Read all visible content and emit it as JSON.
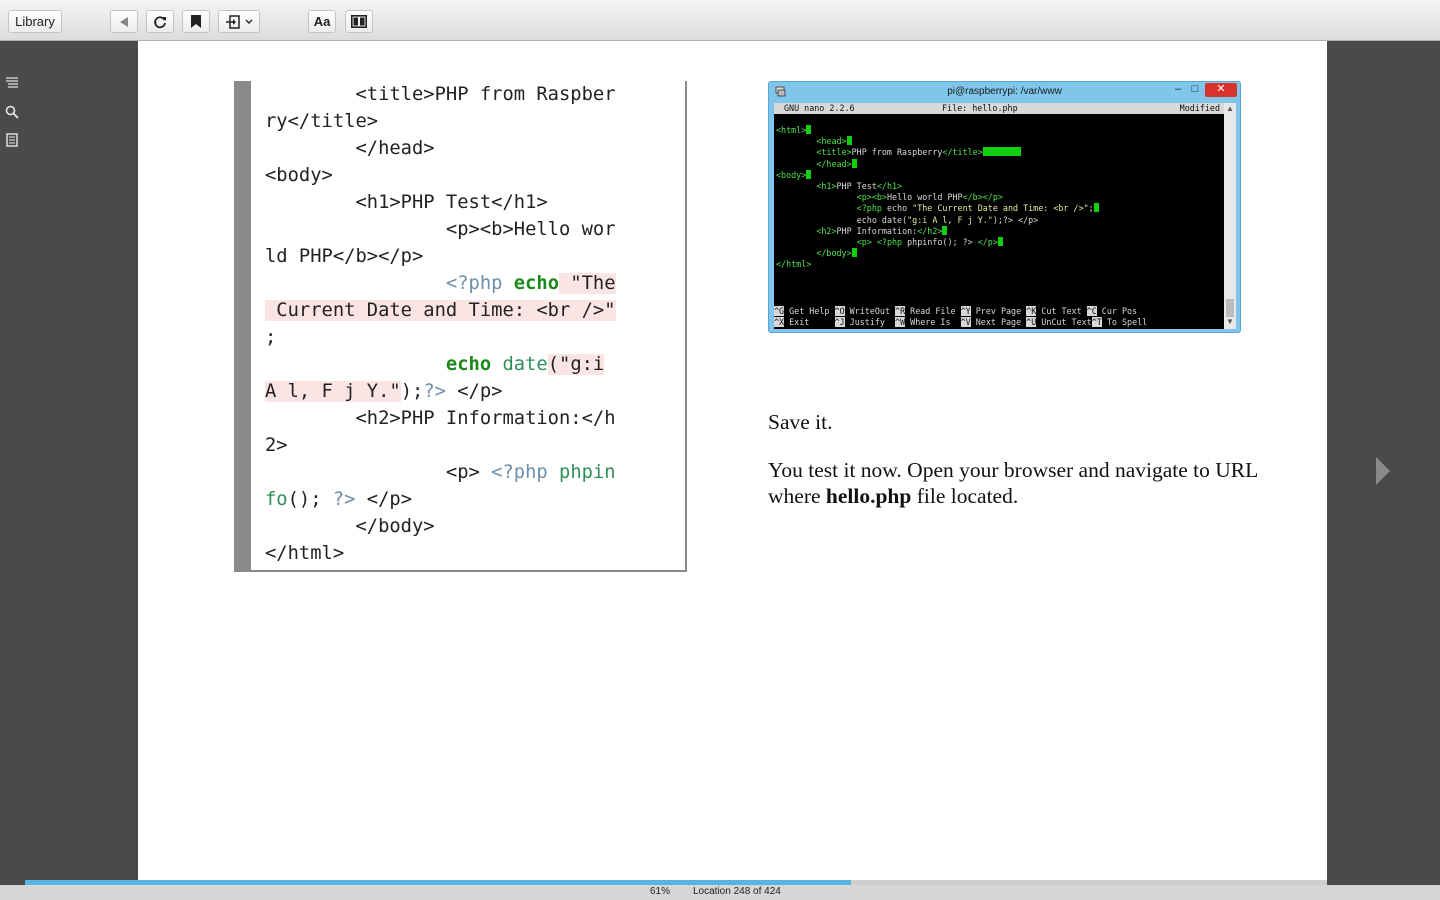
{
  "toolbar": {
    "library_label": "Library",
    "font_label": "Aa"
  },
  "code": {
    "lines": [
      "        <title>PHP from Raspber",
      "ry</title>",
      "        </head>",
      "<body>",
      "        <h1>PHP Test</h1>",
      "                <p><b>Hello wor",
      "ld PHP</b></p>"
    ],
    "echo_line1_indent": "                ",
    "echo_line1_php": "<?php",
    "echo_line1_space": " ",
    "echo_line1_kw": "echo",
    "echo_line1_str": " \"The",
    "echo_line2": " Current Date and Time: <br />\"",
    "echo_line3": ";",
    "date_indent": "                ",
    "date_kw": "echo",
    "date_fn": " date",
    "date_str": "(\"g:i",
    "date_line2_str": "A l, F j Y.\"",
    "date_line2_rest": ");",
    "date_line2_close": "?>",
    "date_line2_tail": " </p>",
    "h2_line1": "        <h2>PHP Information:</h",
    "h2_line2": "2>",
    "info_indent": "                <p> ",
    "info_php": "<?php",
    "info_fn": " phpin",
    "info_line2_fn": "fo",
    "info_line2_rest": "(); ",
    "info_line2_close": "?>",
    "info_line2_tail": " </p>",
    "end_lines": [
      "        </body>",
      "</html>"
    ]
  },
  "terminal": {
    "window_title": "pi@raspberrypi: /var/www",
    "min_label": "–",
    "max_label": "□",
    "close_label": "✕",
    "nano_version": "GNU nano 2.2.6",
    "nano_file": "File: hello.php",
    "nano_status": "Modified",
    "lines": [
      {
        "pre": "",
        "tag": "<html>",
        "post": ""
      },
      {
        "pre": "        ",
        "tag": "<head>",
        "post": ""
      },
      {
        "pre": "        ",
        "tag": "<title>",
        "post": "PHP from Raspberry",
        "tag2": "</title>"
      },
      {
        "pre": "        ",
        "tag": "</head>",
        "post": ""
      },
      {
        "pre": "",
        "tag": "<body>",
        "post": ""
      },
      {
        "pre": "        ",
        "tag": "<h1>",
        "post": "PHP Test",
        "tag2": "</h1>"
      },
      {
        "pre": "                ",
        "tag": "<p><b>",
        "post": "Hello world PHP",
        "tag2": "</b></p>"
      },
      {
        "pre": "                ",
        "tag": "<?php",
        "post": " echo ",
        "tag2": "\"The Current Date and Time: <br />\";"
      },
      {
        "pre": "                ",
        "tag": "",
        "post": "echo date(",
        "tag2": "\"g:i A l, F j Y.\"",
        "post2": ");?> </p>"
      },
      {
        "pre": "        ",
        "tag": "<h2>",
        "post": "PHP Information:",
        "tag2": "</h2>"
      },
      {
        "pre": "                ",
        "tag": "<p> <?php",
        "post": " phpinfo(); ?> ",
        "tag2": "</p>"
      },
      {
        "pre": "        ",
        "tag": "</body>",
        "post": ""
      },
      {
        "pre": "",
        "tag": "</html>",
        "post": ""
      }
    ],
    "footer_row1": [
      {
        "key": "^G",
        "label": " Get Help "
      },
      {
        "key": "^O",
        "label": " WriteOut "
      },
      {
        "key": "^R",
        "label": " Read File "
      },
      {
        "key": "^Y",
        "label": " Prev Page "
      },
      {
        "key": "^K",
        "label": " Cut Text "
      },
      {
        "key": "^C",
        "label": " Cur Pos"
      }
    ],
    "footer_row2": [
      {
        "key": "^X",
        "label": " Exit     "
      },
      {
        "key": "^J",
        "label": " Justify  "
      },
      {
        "key": "^W",
        "label": " Where Is  "
      },
      {
        "key": "^V",
        "label": " Next Page "
      },
      {
        "key": "^U",
        "label": " UnCut Text"
      },
      {
        "key": "^T",
        "label": " To Spell"
      }
    ]
  },
  "prose": {
    "save": "Save it.",
    "test_pre": "You test it now. Open your browser and navigate to URL where ",
    "test_bold": "hello.php",
    "test_post": " file located."
  },
  "status": {
    "percent": "61%",
    "location": "Location 248 of 424",
    "progress_fraction": 0.61
  },
  "colors": {
    "progress": "#5ab4e0",
    "keyword": "#1b8a1b",
    "highlight": "#fbe4e4"
  }
}
